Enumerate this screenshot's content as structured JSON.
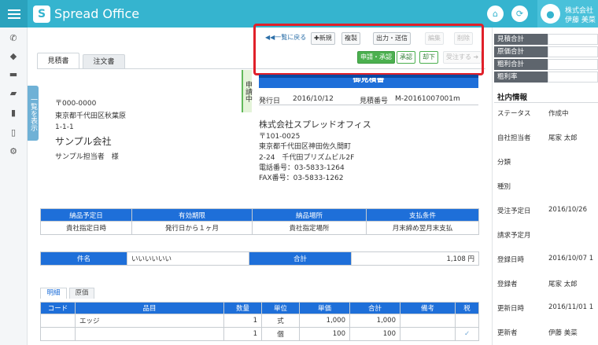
{
  "header": {
    "logo_text": "Spread Office",
    "logo_mark": "S",
    "user_company": "株式会社",
    "user_name": "伊藤 美菜"
  },
  "sidebar": {
    "list_tab": "一覧を表示"
  },
  "doc_tabs": [
    "見積書",
    "注文書"
  ],
  "toolbar": {
    "back": "◀◀一覧に戻る",
    "new": "✚新規",
    "copy": "複製",
    "output": "出力・送信",
    "edit": "編集",
    "delete": "削除",
    "apply": "申請・承認",
    "approve": "承認",
    "reject": "却下",
    "order": "受注する ➔"
  },
  "status_ribbon": "申請中",
  "customer": {
    "zip": "〒000-0000",
    "address1": "東京都千代田区秋葉原",
    "address2": "1-1-1",
    "company": "サンプル会社",
    "person": "サンプル担当者　様"
  },
  "document": {
    "title": "御見積書",
    "issue_date_label": "発行日",
    "issue_date": "2016/10/12",
    "number_label": "見積番号",
    "number": "M-20161007001m"
  },
  "issuer": {
    "company": "株式会社スプレッドオフィス",
    "zip": "〒101-0025",
    "address1": "東京都千代田区神田佐久間町",
    "address2": "2-24　千代田プリズムビル2F",
    "tel": "電話番号：03-5833-1264",
    "fax": "FAX番号：03-5833-1262"
  },
  "terms": {
    "headers": [
      "納品予定日",
      "有効期限",
      "納品場所",
      "支払条件"
    ],
    "values": [
      "貴社指定日時",
      "発行日から１ヶ月",
      "貴社指定場所",
      "月末締め翌月末支払"
    ]
  },
  "subject": {
    "label": "件名",
    "value": "いいいいいい",
    "total_label": "合計",
    "total_value": "1,108 円"
  },
  "detail_tabs": [
    "明細",
    "原価"
  ],
  "items": {
    "headers": [
      "コード",
      "品目",
      "数量",
      "単位",
      "単価",
      "合計",
      "備考",
      "税"
    ],
    "rows": [
      [
        "",
        "エッジ",
        "1",
        "式",
        "1,000",
        "1,000",
        "",
        ""
      ],
      [
        "",
        "",
        "1",
        "個",
        "100",
        "100",
        "",
        "✓"
      ]
    ]
  },
  "summary": [
    {
      "label": "見積合計",
      "value": ""
    },
    {
      "label": "原価合計",
      "value": ""
    },
    {
      "label": "粗利合計",
      "value": ""
    },
    {
      "label": "粗利率",
      "value": ""
    }
  ],
  "info": {
    "title": "社内情報",
    "fields": [
      {
        "label": "ステータス",
        "value": "作成中"
      },
      {
        "label": "自社担当者",
        "value": "尾家 太郎"
      },
      {
        "label": "分類",
        "value": ""
      },
      {
        "label": "種別",
        "value": ""
      },
      {
        "label": "受注予定日",
        "value": "2016/10/26"
      },
      {
        "label": "請求予定月",
        "value": ""
      },
      {
        "label": "登録日時",
        "value": "2016/10/07 1"
      },
      {
        "label": "登録者",
        "value": "尾家 太郎"
      },
      {
        "label": "更新日時",
        "value": "2016/11/01 1"
      },
      {
        "label": "更新者",
        "value": "伊藤 美菜"
      }
    ]
  },
  "colors": {
    "brand": "#35b4cf",
    "table_header": "#1e6fd9",
    "approve_green": "#4bb04f",
    "highlight_red": "#e0202a"
  },
  "icons": [
    "menu-icon",
    "home-icon",
    "refresh-icon",
    "user-icon",
    "phone-icon",
    "tag-icon",
    "card-icon",
    "folder-icon",
    "chart-icon",
    "file-icon",
    "gear-icon"
  ]
}
